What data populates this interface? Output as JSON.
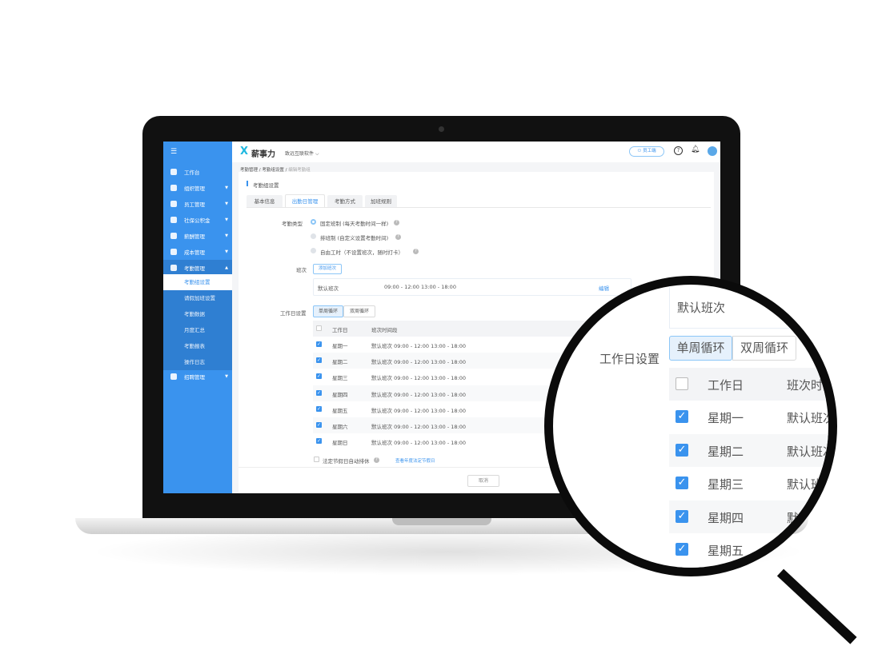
{
  "app": {
    "logo": "薪事力",
    "company": "致远互联软件",
    "employee_portal": "员工端",
    "accent": "#3a93ee"
  },
  "sidebar": {
    "items": [
      {
        "label": "工作台",
        "icon": "monitor-icon",
        "expandable": false
      },
      {
        "label": "组织管理",
        "icon": "org-icon",
        "expandable": true
      },
      {
        "label": "员工管理",
        "icon": "user-icon",
        "expandable": true
      },
      {
        "label": "社保公积金",
        "icon": "shield-icon",
        "expandable": true
      },
      {
        "label": "薪酬管理",
        "icon": "money-icon",
        "expandable": true
      },
      {
        "label": "成本管理",
        "icon": "calculator-icon",
        "expandable": true
      },
      {
        "label": "考勤管理",
        "icon": "clock-icon",
        "expandable": true,
        "expanded": true
      },
      {
        "label": "招聘管理",
        "icon": "briefcase-icon",
        "expandable": true
      }
    ],
    "submenu": [
      "考勤组设置",
      "请假加班设置",
      "考勤数据",
      "月度汇总",
      "考勤报表",
      "操作日志"
    ]
  },
  "breadcrumb": [
    "考勤管理",
    "考勤组设置",
    "编辑考勤组"
  ],
  "section_title": "考勤组设置",
  "tabs": [
    "基本信息",
    "出勤日管理",
    "考勤方式",
    "加班规则"
  ],
  "form": {
    "type_label": "考勤类型",
    "types": [
      "固定班制 (每天考勤时间一样)",
      "排班制 (自定义设置考勤时间)",
      "自由工时（不设置班次，随时打卡）"
    ],
    "shift_label": "班次",
    "add_shift": "添加班次",
    "shift_name": "默认班次",
    "shift_time": "09:00 - 12:00 13:00 - 18:00",
    "edit": "编辑",
    "workday_label": "工作日设置",
    "cycle": [
      "单周循环",
      "双周循环"
    ],
    "table_headers": [
      "工作日",
      "班次时间段"
    ],
    "rows": [
      {
        "day": "星期一",
        "shift": "默认班次 09:00 - 12:00 13:00 - 18:00",
        "checked": true
      },
      {
        "day": "星期二",
        "shift": "默认班次 09:00 - 12:00 13:00 - 18:00",
        "checked": true
      },
      {
        "day": "星期三",
        "shift": "默认班次 09:00 - 12:00 13:00 - 18:00",
        "checked": true
      },
      {
        "day": "星期四",
        "shift": "默认班次 09:00 - 12:00 13:00 - 18:00",
        "checked": true
      },
      {
        "day": "星期五",
        "shift": "默认班次 09:00 - 12:00 13:00 - 18:00",
        "checked": true
      },
      {
        "day": "星期六",
        "shift": "默认班次 09:00 - 12:00 13:00 - 18:00",
        "checked": true
      },
      {
        "day": "星期日",
        "shift": "默认班次 09:00 - 12:00 13:00 - 18:00",
        "checked": true
      }
    ],
    "holiday": "法定节假日自动排休",
    "holiday_link": "查看年度法定节假日",
    "cancel": "取消"
  },
  "magnifier": {
    "shift_time_cut": "默认班次",
    "header_cut": "班次时间"
  }
}
